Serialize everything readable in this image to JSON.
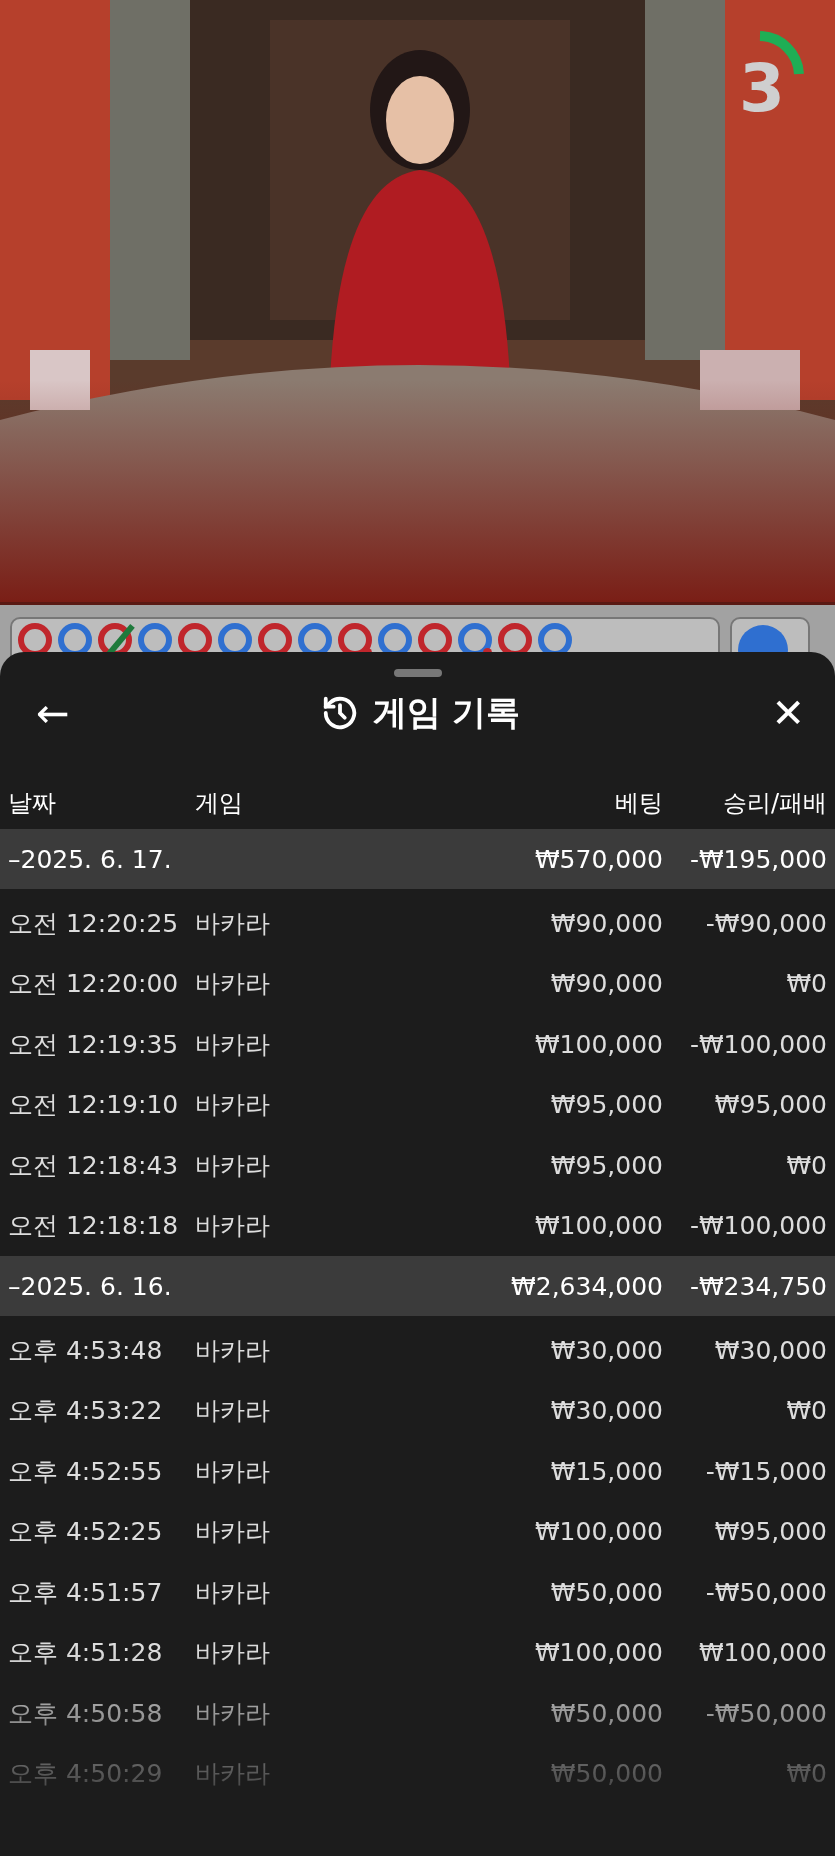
{
  "timer": {
    "count": "3"
  },
  "road": [
    {
      "color": "#c0262c",
      "tie": false,
      "pair": false
    },
    {
      "color": "#2f6fd0",
      "tie": false,
      "pair": false
    },
    {
      "color": "#c0262c",
      "tie": true,
      "pair": false
    },
    {
      "color": "#2f6fd0",
      "tie": false,
      "pair": false
    },
    {
      "color": "#c0262c",
      "tie": false,
      "pair": false
    },
    {
      "color": "#2f6fd0",
      "tie": false,
      "pair": false
    },
    {
      "color": "#c0262c",
      "tie": false,
      "pair": false
    },
    {
      "color": "#2f6fd0",
      "tie": false,
      "pair": false
    },
    {
      "color": "#c0262c",
      "tie": false,
      "pair": true
    },
    {
      "color": "#2f6fd0",
      "tie": false,
      "pair": false
    },
    {
      "color": "#c0262c",
      "tie": false,
      "pair": false
    },
    {
      "color": "#2f6fd0",
      "tie": false,
      "pair": true
    },
    {
      "color": "#c0262c",
      "tie": false,
      "pair": false
    },
    {
      "color": "#2f6fd0",
      "tie": false,
      "pair": false
    }
  ],
  "sheet": {
    "title": "게임 기록",
    "back": "←",
    "close": "✕"
  },
  "columns": [
    "날짜",
    "게임",
    "베팅",
    "승리/패배"
  ],
  "groups": [
    {
      "date": "–2025. 6. 17.",
      "bet": "₩570,000",
      "result": "-₩195,000",
      "rows": [
        {
          "time": "오전 12:20:25",
          "game": "바카라",
          "bet": "₩90,000",
          "result": "-₩90,000"
        },
        {
          "time": "오전 12:20:00",
          "game": "바카라",
          "bet": "₩90,000",
          "result": "₩0"
        },
        {
          "time": "오전 12:19:35",
          "game": "바카라",
          "bet": "₩100,000",
          "result": "-₩100,000"
        },
        {
          "time": "오전 12:19:10",
          "game": "바카라",
          "bet": "₩95,000",
          "result": "₩95,000"
        },
        {
          "time": "오전 12:18:43",
          "game": "바카라",
          "bet": "₩95,000",
          "result": "₩0"
        },
        {
          "time": "오전 12:18:18",
          "game": "바카라",
          "bet": "₩100,000",
          "result": "-₩100,000"
        }
      ]
    },
    {
      "date": "–2025. 6. 16.",
      "bet": "₩2,634,000",
      "result": "-₩234,750",
      "rows": [
        {
          "time": "오후 4:53:48",
          "game": "바카라",
          "bet": "₩30,000",
          "result": "₩30,000"
        },
        {
          "time": "오후 4:53:22",
          "game": "바카라",
          "bet": "₩30,000",
          "result": "₩0"
        },
        {
          "time": "오후 4:52:55",
          "game": "바카라",
          "bet": "₩15,000",
          "result": "-₩15,000"
        },
        {
          "time": "오후 4:52:25",
          "game": "바카라",
          "bet": "₩100,000",
          "result": "₩95,000"
        },
        {
          "time": "오후 4:51:57",
          "game": "바카라",
          "bet": "₩50,000",
          "result": "-₩50,000"
        },
        {
          "time": "오후 4:51:28",
          "game": "바카라",
          "bet": "₩100,000",
          "result": "₩100,000"
        },
        {
          "time": "오후 4:50:58",
          "game": "바카라",
          "bet": "₩50,000",
          "result": "-₩50,000"
        },
        {
          "time": "오후 4:50:29",
          "game": "바카라",
          "bet": "₩50,000",
          "result": "₩0"
        }
      ]
    }
  ]
}
